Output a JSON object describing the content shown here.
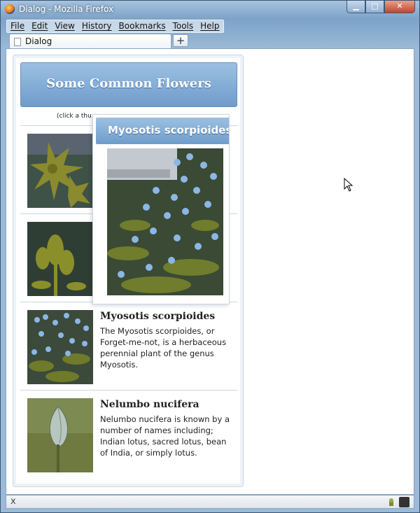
{
  "window": {
    "title": "Dialog - Mozilla Firefox",
    "minimize_glyph": "▁",
    "maximize_glyph": "□",
    "close_glyph": "✕"
  },
  "menubar": {
    "items": [
      "File",
      "Edit",
      "View",
      "History",
      "Bookmarks",
      "Tools",
      "Help"
    ]
  },
  "tabs": {
    "active_label": "Dialog",
    "new_tab_glyph": "+"
  },
  "statusbar": {
    "close_glyph": "x"
  },
  "page": {
    "header_title": "Some Common Flowers",
    "hint": "(click a thu",
    "flowers": [
      {
        "name": "",
        "description": ""
      },
      {
        "name": "",
        "description": ""
      },
      {
        "name": "Myosotis scorpioides",
        "description": "The Myosotis scorpioides, or Forget-me-not, is a herbaceous perennial plant of the genus Myosotis."
      },
      {
        "name": "Nelumbo nucifera",
        "description": "Nelumbo nucifera is known by a number of names including; Indian lotus, sacred lotus, bean of India, or simply lotus."
      }
    ]
  },
  "popup": {
    "title": "Myosotis scorpioides"
  },
  "colors": {
    "header_blue": "#7fa8d4",
    "border": "#c9d7e6"
  }
}
